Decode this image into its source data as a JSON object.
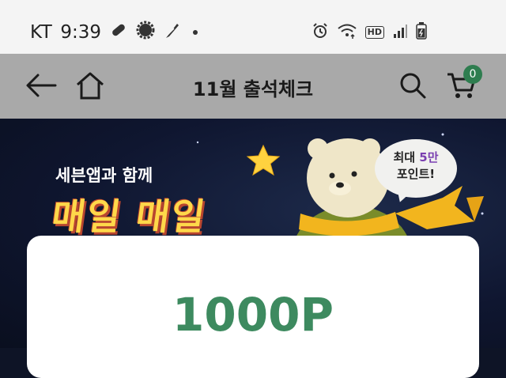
{
  "status_bar": {
    "carrier": "KT",
    "time": "9:39",
    "left_icons": [
      "pill-icon",
      "gear-badge-icon",
      "feather-icon",
      "dot-icon"
    ],
    "right_icons": [
      "alarm-icon",
      "wifi-icon",
      "hd-icon",
      "signal-icon",
      "battery-charging-icon"
    ],
    "hd_label": "HD"
  },
  "app_bar": {
    "title": "11월 출석체크",
    "back_icon": "back-arrow-icon",
    "home_icon": "home-icon",
    "search_icon": "search-icon",
    "cart_icon": "cart-icon",
    "cart_count": "0",
    "background": "#a9a9a9"
  },
  "banner": {
    "subtitle": "세븐앱과 함께",
    "headline": "매일 매일",
    "bubble_prefix": "최대 ",
    "bubble_accent": "5만",
    "bubble_line2": "포인트!"
  },
  "card": {
    "points": "1000P",
    "points_color": "#3d8a5f"
  }
}
